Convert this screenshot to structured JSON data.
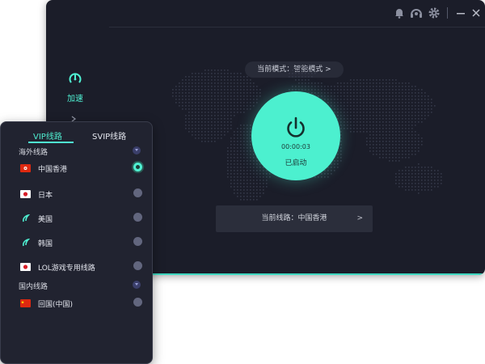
{
  "main": {
    "mode_label": "当前模式：智能模式 >",
    "timer": "00:00:03",
    "status": "已启动",
    "current_route_label": "当前线路：中国香港",
    "current_route_arrow": ">"
  },
  "nav": {
    "accelerate_label": "加速"
  },
  "colors": {
    "accent": "#4cf0cf",
    "window_bg": "#1b1d29",
    "panel_bg": "#212330"
  },
  "panel": {
    "tabs": [
      {
        "label": "VIP线路",
        "active": true
      },
      {
        "label": "SVIP线路",
        "active": false
      }
    ],
    "groups": [
      {
        "title": "海外线路",
        "routes": [
          {
            "name": "中国香港",
            "flag": "hk-flag",
            "selected": true
          },
          {
            "name": "日本",
            "flag": "jp-flag",
            "selected": false
          },
          {
            "name": "美国",
            "flag": "route-icon",
            "selected": false
          },
          {
            "name": "韩国",
            "flag": "route-icon",
            "selected": false
          },
          {
            "name": "LOL游戏专用线路",
            "flag": "jp-flag",
            "selected": false
          }
        ]
      },
      {
        "title": "国内线路",
        "routes": [
          {
            "name": "回国(中国)",
            "flag": "cn-flag",
            "selected": false
          }
        ]
      }
    ]
  }
}
